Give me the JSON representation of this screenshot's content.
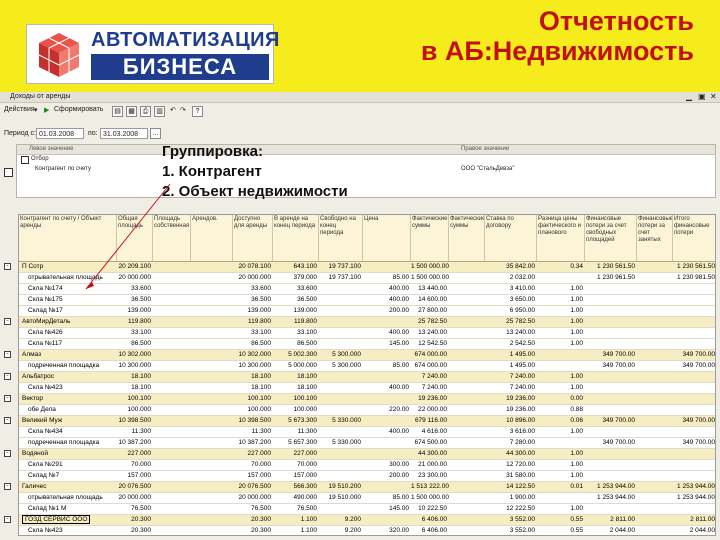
{
  "slide": {
    "title_line1": "Отчетность",
    "title_line2": "в АБ:Недвижимость",
    "logo_top": "АВТОМАТИЗАЦИЯ",
    "logo_bottom": "БИЗНЕСА",
    "colors": {
      "background": "#f6ec1c",
      "title": "#c0101a",
      "logo_blue": "#1f3d8c"
    }
  },
  "window": {
    "title": "Доходы от аренды",
    "toolbar": {
      "actions": "Действия",
      "generate": "Сформировать"
    },
    "period_label": "Период с:",
    "period_from": "01.03.2008",
    "period_to_label": "по:",
    "period_to": "31.03.2008",
    "filter": {
      "col_left": "Левое значение",
      "col_right": "Правое значение",
      "row1_label": "Отбор",
      "row2_label": "Контрагент по счету",
      "row2_value": "ООО \"СтальДевза\""
    }
  },
  "overlay": {
    "heading": "Группировка:",
    "item1": "1. Контрагент",
    "item2": "2. Объект недвижимости"
  },
  "report": {
    "headers": [
      "Контрагент по счету / Объект аренды",
      "Общая площадь",
      "Площадь собственная",
      "Арендов.",
      "Доступно для аренды",
      "В аренде на конец периода",
      "Свободно на конец периода",
      "Цена",
      "Фактические суммы",
      "Фактические суммы",
      "Ставка по договору",
      "Разница цены фактического и планового",
      "Финансовые потери за счет свободных площадей",
      "Финансовые потери за счет занятых",
      "Итого финансовые потери"
    ],
    "rows": [
      {
        "level": 0,
        "name": "П Сотр",
        "c": [
          "20 209.100",
          "",
          "",
          "20 078.100",
          "643.100",
          "19 737.100",
          "",
          "1 500 000.00",
          "",
          "35 842.00",
          "0.34",
          "1 230 561.50",
          "",
          "1 230 561.50"
        ]
      },
      {
        "level": 1,
        "name": "отрывательная площадь",
        "c": [
          "20 000.000",
          "",
          "",
          "20 000.000",
          "379.000",
          "19 737.100",
          "85.00",
          "1 500 000.00",
          "",
          "2 032.00",
          "",
          "1 230 961.50",
          "",
          "1 230 981.50"
        ]
      },
      {
        "level": 1,
        "name": "Скла №174",
        "c": [
          "33.600",
          "",
          "",
          "33.600",
          "33.600",
          "",
          "400.00",
          "13 440.00",
          "",
          "3 410.00",
          "1.00",
          "",
          "",
          ""
        ]
      },
      {
        "level": 1,
        "name": "Скла №175",
        "c": [
          "36.500",
          "",
          "",
          "36.500",
          "36.500",
          "",
          "400.00",
          "14 600.00",
          "",
          "3 650.00",
          "1.00",
          "",
          "",
          ""
        ]
      },
      {
        "level": 1,
        "name": "Склад №17",
        "c": [
          "139.000",
          "",
          "",
          "139.000",
          "139.000",
          "",
          "200.00",
          "27 800.00",
          "",
          "6 950.00",
          "1.00",
          "",
          "",
          ""
        ]
      },
      {
        "level": 0,
        "name": "АвтоМирДеталь",
        "c": [
          "119.800",
          "",
          "",
          "119.800",
          "119.800",
          "",
          "",
          "25 782.50",
          "",
          "25 782.50",
          "1.00",
          "",
          "",
          ""
        ]
      },
      {
        "level": 1,
        "name": "Скла №426",
        "c": [
          "33.100",
          "",
          "",
          "33.100",
          "33.100",
          "",
          "400.00",
          "13 240.00",
          "",
          "13 240.00",
          "1.00",
          "",
          "",
          ""
        ]
      },
      {
        "level": 1,
        "name": "Скла №117",
        "c": [
          "86.500",
          "",
          "",
          "86.500",
          "86.500",
          "",
          "145.00",
          "12 542.50",
          "",
          "2 542.50",
          "1.00",
          "",
          "",
          ""
        ]
      },
      {
        "level": 0,
        "name": "Алмаз",
        "c": [
          "10 302.000",
          "",
          "",
          "10 302.000",
          "5 002.300",
          "5 300.000",
          "",
          "674 000.00",
          "",
          "1 495.00",
          "",
          "349 700.00",
          "",
          "349 700.00"
        ]
      },
      {
        "level": 1,
        "name": "подреченная площадка",
        "c": [
          "10 300.000",
          "",
          "",
          "10 300.000",
          "5 000.000",
          "5 300.000",
          "85.00",
          "674 000.00",
          "",
          "1 495.00",
          "",
          "349 700.00",
          "",
          "349 700.00"
        ]
      },
      {
        "level": 0,
        "name": "Альбатрос",
        "c": [
          "18.100",
          "",
          "",
          "18.100",
          "18.100",
          "",
          "",
          "7 240.00",
          "",
          "7 240.00",
          "1.00",
          "",
          "",
          ""
        ]
      },
      {
        "level": 1,
        "name": "Скла №423",
        "c": [
          "18.100",
          "",
          "",
          "18.100",
          "18.100",
          "",
          "400.00",
          "7 240.00",
          "",
          "7 240.00",
          "1.00",
          "",
          "",
          ""
        ]
      },
      {
        "level": 0,
        "name": "Вектор",
        "c": [
          "100.100",
          "",
          "",
          "100.100",
          "100.100",
          "",
          "",
          "19 236.00",
          "",
          "19 236.00",
          "0.00",
          "",
          "",
          ""
        ]
      },
      {
        "level": 1,
        "name": "обе Дела",
        "c": [
          "100.000",
          "",
          "",
          "100.000",
          "100.000",
          "",
          "220.00",
          "22 000.00",
          "",
          "19 236.00",
          "0.88",
          "",
          "",
          ""
        ]
      },
      {
        "level": 0,
        "name": "Великий Муж",
        "c": [
          "10 398.500",
          "",
          "",
          "10 398.500",
          "5 673.300",
          "5 330.000",
          "",
          "679 116.00",
          "",
          "10 896.00",
          "0.06",
          "349 700.00",
          "",
          "349 700.00"
        ]
      },
      {
        "level": 1,
        "name": "Скла №434",
        "c": [
          "11.300",
          "",
          "",
          "11.300",
          "11.300",
          "",
          "400.00",
          "4 616.00",
          "",
          "3 616.00",
          "1.00",
          "",
          "",
          ""
        ]
      },
      {
        "level": 1,
        "name": "подреченная площадка",
        "c": [
          "10 387.200",
          "",
          "",
          "10 387.200",
          "5 657.300",
          "5 330.000",
          "",
          "674 500.00",
          "",
          "7 280.00",
          "",
          "349 700.00",
          "",
          "349 700.00"
        ]
      },
      {
        "level": 0,
        "name": "Водяной",
        "c": [
          "227.000",
          "",
          "",
          "227.000",
          "227.000",
          "",
          "",
          "44 300.00",
          "",
          "44 300.00",
          "1.00",
          "",
          "",
          ""
        ]
      },
      {
        "level": 1,
        "name": "Скла №291",
        "c": [
          "70.000",
          "",
          "",
          "70.000",
          "70.000",
          "",
          "300.00",
          "21 000.00",
          "",
          "12 720.00",
          "1.00",
          "",
          "",
          ""
        ]
      },
      {
        "level": 1,
        "name": "Склад №7",
        "c": [
          "157.000",
          "",
          "",
          "157.000",
          "157.000",
          "",
          "200.00",
          "23 300.00",
          "",
          "31 580.00",
          "1.00",
          "",
          "",
          ""
        ]
      },
      {
        "level": 0,
        "name": "Галичес",
        "c": [
          "20 076.500",
          "",
          "",
          "20 076.500",
          "566.300",
          "19 510.200",
          "",
          "1 513 222.00",
          "",
          "14 122.50",
          "0.01",
          "1 253 944.00",
          "",
          "1 253 944.00"
        ]
      },
      {
        "level": 1,
        "name": "отрывательная площадь",
        "c": [
          "20 000.000",
          "",
          "",
          "20 000.000",
          "490.000",
          "19 510.000",
          "85.00",
          "1 500 000.00",
          "",
          "1 900.00",
          "",
          "1 253 944.00",
          "",
          "1 253 944.00"
        ]
      },
      {
        "level": 1,
        "name": "Склад №1 М",
        "c": [
          "76.500",
          "",
          "",
          "76.500",
          "76.500",
          "",
          "145.00",
          "10 222.50",
          "",
          "12 222.50",
          "1.00",
          "",
          "",
          ""
        ]
      },
      {
        "level": 0,
        "name": "ГОЗД СЕРВИС ООО",
        "c": [
          "20.300",
          "",
          "",
          "20.300",
          "1.100",
          "9.200",
          "",
          "6 406.00",
          "",
          "3 552.00",
          "0.55",
          "2 811.00",
          "",
          "2 811.00"
        ],
        "selected": true
      },
      {
        "level": 1,
        "name": "Скла №423",
        "c": [
          "20.300",
          "",
          "",
          "20.300",
          "1.100",
          "9.200",
          "320.00",
          "6 406.00",
          "",
          "3 552.00",
          "0.55",
          "2 044.00",
          "",
          "2 044.00"
        ]
      }
    ]
  }
}
